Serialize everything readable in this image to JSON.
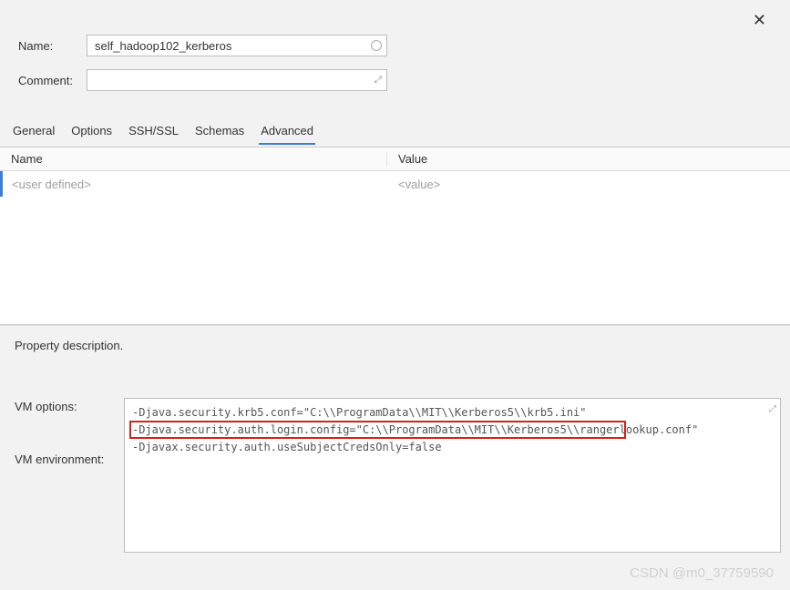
{
  "close_icon": "✕",
  "form": {
    "name_label": "Name:",
    "name_value": "self_hadoop102_kerberos",
    "comment_label": "Comment:",
    "comment_value": ""
  },
  "tabs": {
    "general": "General",
    "options": "Options",
    "sshssl": "SSH/SSL",
    "schemas": "Schemas",
    "advanced": "Advanced"
  },
  "table": {
    "header_name": "Name",
    "header_value": "Value",
    "row_name_placeholder": "<user defined>",
    "row_value_placeholder": "<value>"
  },
  "property_description_label": "Property description.",
  "vm": {
    "options_label": "VM options:",
    "environment_label": "VM environment:",
    "line1": "-Djava.security.krb5.conf=\"C:\\\\ProgramData\\\\MIT\\\\Kerberos5\\\\krb5.ini\"",
    "line2": "-Djava.security.auth.login.config=\"C:\\\\ProgramData\\\\MIT\\\\Kerberos5\\\\rangerlookup.conf\"",
    "line3": "-Djavax.security.auth.useSubjectCredsOnly=false"
  },
  "watermark": "CSDN @m0_37759590"
}
